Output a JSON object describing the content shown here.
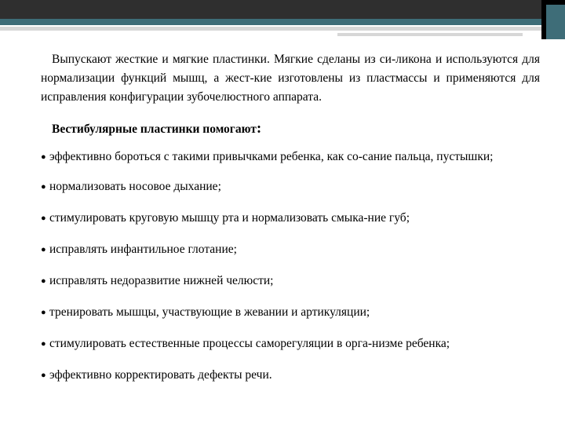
{
  "intro": "Выпускают жесткие и мягкие пластинки. Мягкие сделаны из си-ликона и используются для нормализации функций мышц, а жест-кие изготовлены из пластмассы и применяются для исправления конфигурации зубочелюстного аппарата.",
  "heading": "Вестибулярные пластинки помогают",
  "heading_colon": ":",
  "bullet_glyph": "●",
  "items": [
    "эффективно бороться с такими привычками ребенка, как со-сание пальца, пустышки;",
    "нормализовать носовое дыхание;",
    "стимулировать круговую мышцу рта и нормализовать смыка-ние губ;",
    "исправлять инфантильное глотание;",
    "исправлять недоразвитие нижней челюсти;",
    "тренировать мышцы, участвующие в жевании и артикуляции;",
    "стимулировать естественные процессы саморегуляции в орга-низме ребенка;",
    "эффективно корректировать дефекты речи."
  ],
  "colors": {
    "band_dark": "#2f2f2f",
    "band_teal": "#3e6d78",
    "band_grey": "#d7d7d7"
  }
}
